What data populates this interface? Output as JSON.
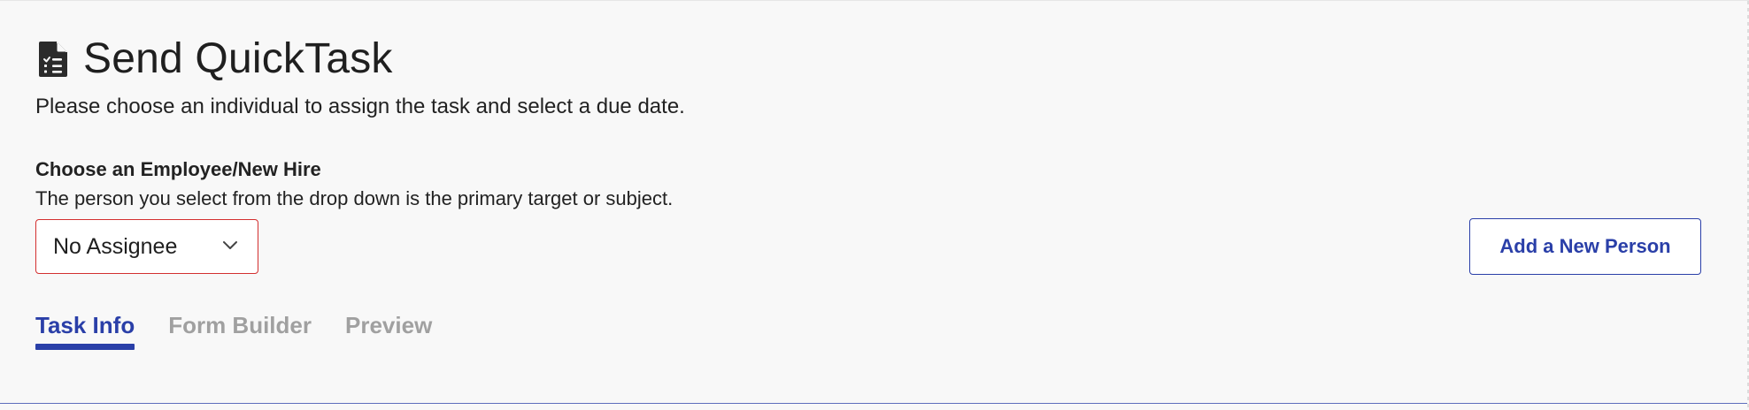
{
  "header": {
    "icon": "document-checklist-icon",
    "title": "Send QuickTask",
    "subtitle": "Please choose an individual to assign the task and select a due date."
  },
  "assignee": {
    "label": "Choose an Employee/New Hire",
    "help": "The person you select from the drop down is the primary target or subject.",
    "selected": "No Assignee",
    "error_color": "#d32f2f"
  },
  "actions": {
    "add_person_label": "Add a New Person"
  },
  "tabs": [
    {
      "label": "Task Info",
      "active": true
    },
    {
      "label": "Form Builder",
      "active": false
    },
    {
      "label": "Preview",
      "active": false
    }
  ],
  "colors": {
    "accent": "#2a3fa8",
    "inactive_tab": "#a0a0a0",
    "background": "#f8f8f8"
  }
}
